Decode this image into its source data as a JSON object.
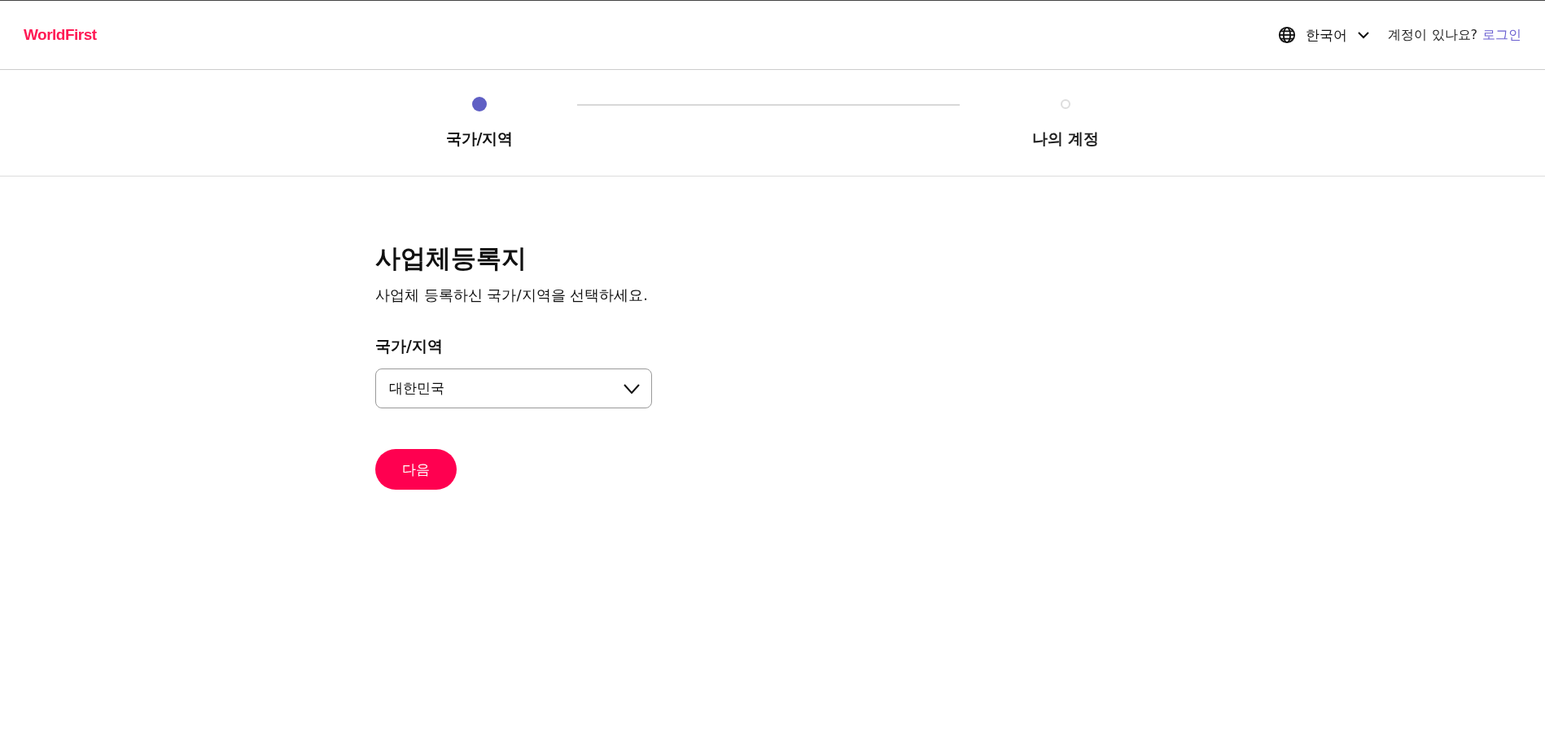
{
  "header": {
    "logo": "WorldFirst",
    "language": "한국어",
    "account_prompt": "계정이 있나요?",
    "login_link": "로그인"
  },
  "steps": [
    {
      "label": "국가/지역",
      "selected": true
    },
    {
      "label": "나의 계정",
      "selected": false
    }
  ],
  "form": {
    "title": "사업체등록지",
    "subtitle": "사업체 등록하신 국가/지역을 선택하세요.",
    "field_label": "국가/지역",
    "select_value": "대한민국",
    "next_button": "다음"
  }
}
